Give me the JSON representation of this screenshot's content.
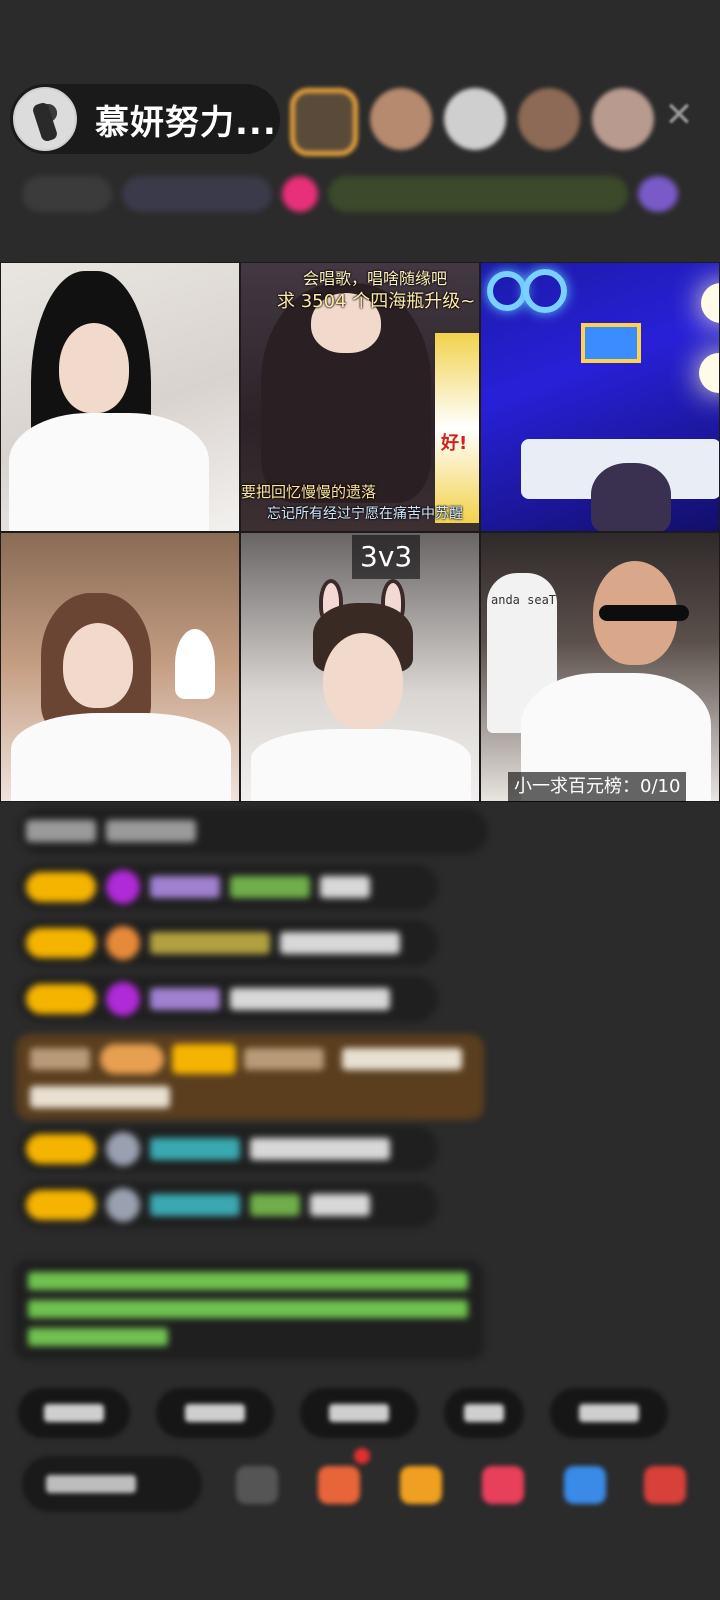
{
  "host": {
    "name": "慕妍努力..."
  },
  "grid": {
    "cell2_caption_top1": "会唱歌，唱啥随缘吧",
    "cell2_caption_top2": "求 3504 个四海瓶升级~",
    "cell2_caption_bottom1": "要把回忆慢慢的遗落",
    "cell2_caption_bottom2": "忘记所有经过宁愿在痛苦中苏醒",
    "cell2_sticker": "好!",
    "pk_mode": "3v3",
    "cell6_rank_tag": "小一求百元榜：0/10",
    "cell6_chair_brand": "anda seaT"
  },
  "colors": {
    "background": "#2b2b2b",
    "level_badge": "#f5b400",
    "notice_text": "#6fc24f",
    "gift_banner": "#5a3e1e"
  },
  "icons": {
    "close": "close-icon",
    "gift": "gift-icon",
    "more": "more-icon"
  }
}
